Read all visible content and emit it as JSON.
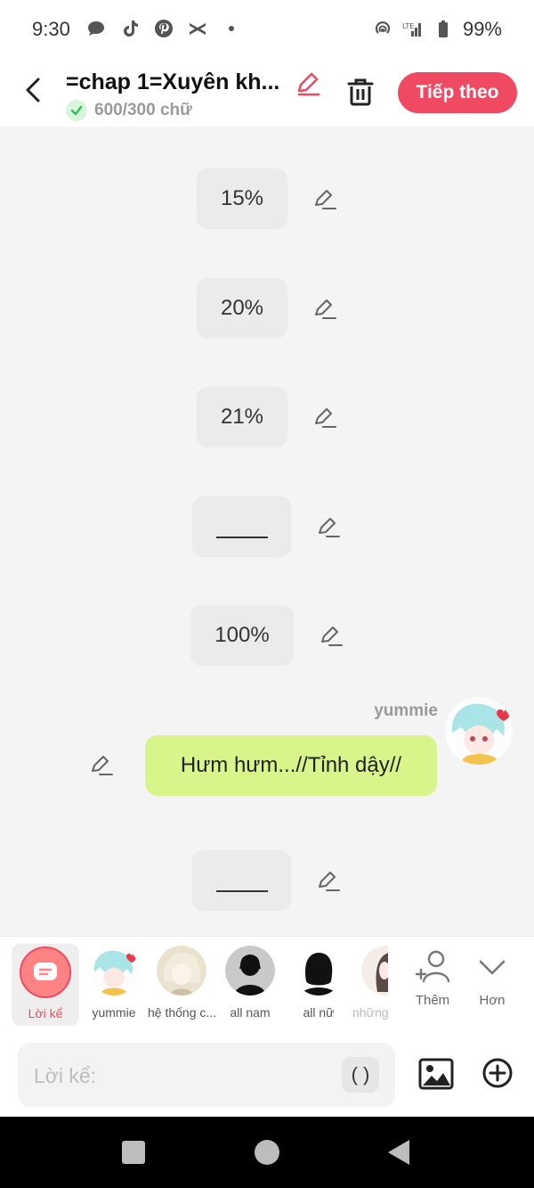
{
  "status_bar": {
    "time": "9:30",
    "battery": "99%",
    "lte_label": "LTE"
  },
  "header": {
    "title": "=chap 1=Xuyên kh...",
    "word_count": "600/300 chữ",
    "next_label": "Tiếp theo"
  },
  "messages": [
    {
      "kind": "narration",
      "text": "15%"
    },
    {
      "kind": "narration",
      "text": "20%"
    },
    {
      "kind": "narration",
      "text": "21%"
    },
    {
      "kind": "narration",
      "text": ""
    },
    {
      "kind": "narration",
      "text": "100%"
    },
    {
      "kind": "dialogue",
      "speaker": "yummie",
      "text": "Hưm hưm...//Tỉnh dậy//"
    },
    {
      "kind": "narration",
      "text": ""
    }
  ],
  "characters": [
    {
      "name": "Lời kể",
      "active": true
    },
    {
      "name": "yummie",
      "active": false
    },
    {
      "name": "hệ thống c...",
      "active": false
    },
    {
      "name": "all nam",
      "active": false
    },
    {
      "name": "all nữ",
      "active": false
    },
    {
      "name": "những",
      "active": false
    }
  ],
  "tools": {
    "add_label": "Thêm",
    "more_label": "Hơn"
  },
  "composer": {
    "placeholder": "Lời kể:",
    "paren_label": "( )"
  },
  "colors": {
    "accent": "#f04a63",
    "bubble": "#d8f58c",
    "narration_bg": "#ebebeb",
    "success": "#2fbf55"
  }
}
